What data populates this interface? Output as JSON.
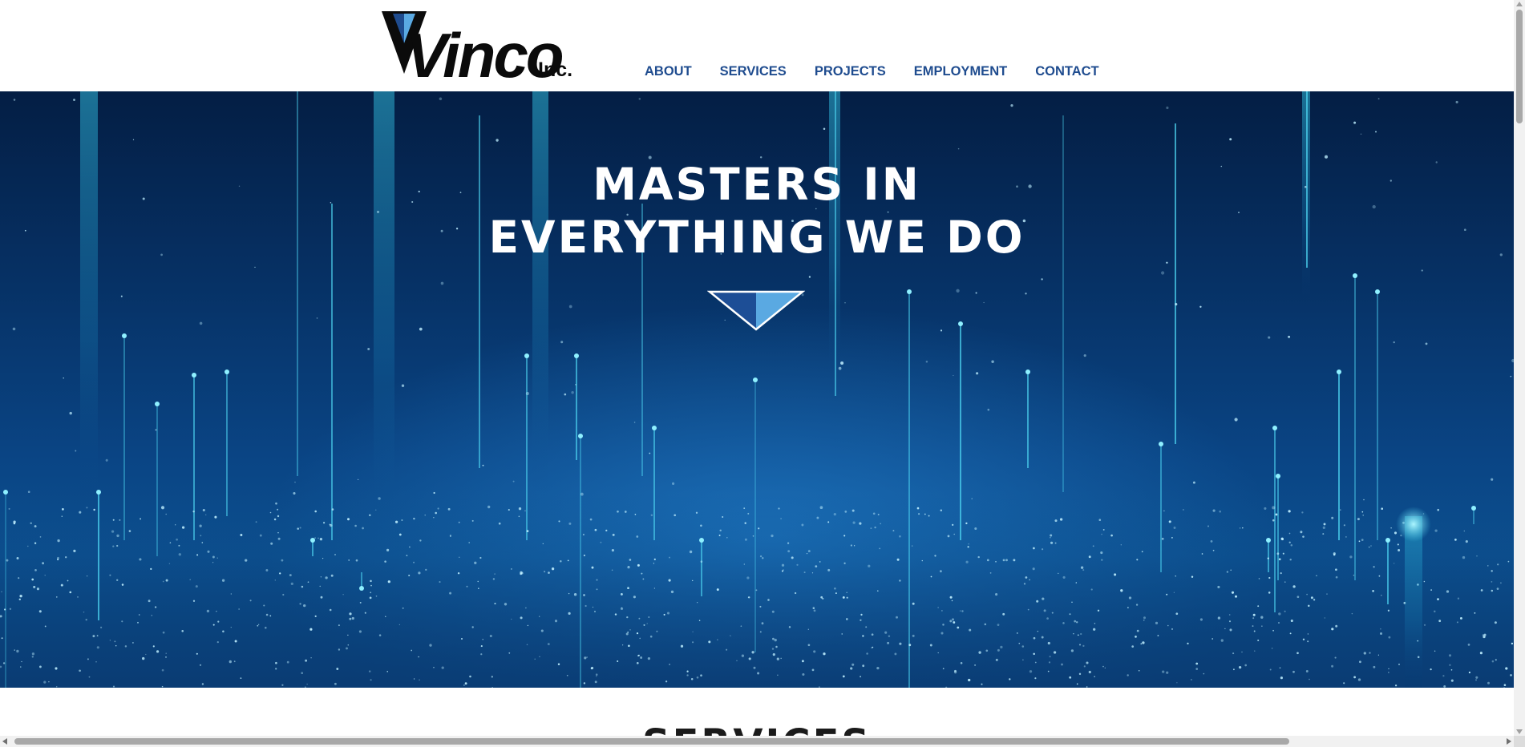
{
  "header": {
    "logo": {
      "wordmark": "Vinco",
      "suffix": "Inc.",
      "icon": "v-triangle-logo-icon"
    },
    "nav": [
      {
        "label": "ABOUT"
      },
      {
        "label": "SERVICES"
      },
      {
        "label": "PROJECTS"
      },
      {
        "label": "EMPLOYMENT"
      },
      {
        "label": "CONTACT"
      }
    ]
  },
  "hero": {
    "title_line1": "MASTERS IN",
    "title_line2": "EVERYTHING WE DO",
    "scroll_icon": "triangle-down-icon"
  },
  "next_section": {
    "title": "SERVICES"
  },
  "colors": {
    "nav_text": "#1f4c8f",
    "hero_dark": "#041e44",
    "hero_mid": "#0a4585",
    "accent_cyan": "#4fd6f2",
    "logo_dark_blue": "#1f4c8f",
    "logo_light_blue": "#5aa9e2"
  }
}
